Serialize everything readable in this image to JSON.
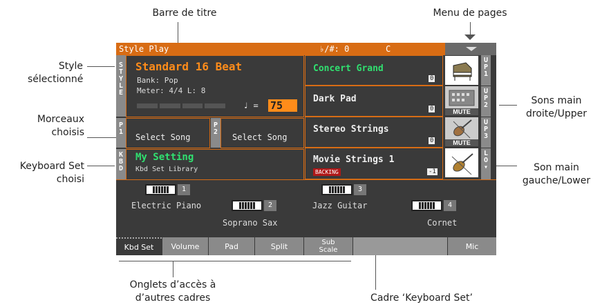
{
  "annotations": {
    "barre_titre": "Barre de titre",
    "menu_pages": "Menu de pages",
    "style_sel_1": "Style",
    "style_sel_2": "sélectionné",
    "morceaux_1": "Morceaux",
    "morceaux_2": "choisis",
    "kbdset_1": "Keyboard Set",
    "kbdset_2": "choisi",
    "upper_1": "Sons main",
    "upper_2": "droite/Upper",
    "lower_1": "Son main",
    "lower_2": "gauche/Lower",
    "onglets_1": "Onglets d’accès à",
    "onglets_2": "d’autres cadres",
    "cadre": "Cadre ‘Keyboard Set’"
  },
  "title_bar": {
    "mode": "Style Play",
    "key_label": "♭/#: 0",
    "chord": "C"
  },
  "side_tabs": {
    "style": "STYLE",
    "p1": "P1",
    "p2": "P2",
    "kbd": "KBD",
    "up1": "UP1",
    "up2": "UP2",
    "up3": "UP3",
    "lo": "LO"
  },
  "style": {
    "name": "Standard 16 Beat",
    "bank": "Bank: Pop",
    "meter": "Meter: 4/4 L:  8",
    "tempo_symbol": "♩ =",
    "tempo": "75"
  },
  "songs": {
    "p1": "Select Song",
    "p2": "Select Song"
  },
  "kbd_set": {
    "name": "My Setting",
    "library": "Kbd Set Library"
  },
  "sounds": [
    {
      "name": "Concert Grand",
      "octave": "0",
      "badge": ""
    },
    {
      "name": "Dark Pad",
      "octave": "0",
      "badge": "MUTE"
    },
    {
      "name": "Stereo Strings",
      "octave": "0",
      "badge": "MUTE"
    },
    {
      "name": "Movie Strings 1",
      "octave": "-1",
      "badge": "BACKING"
    }
  ],
  "pads": [
    {
      "name": "Electric Piano",
      "num": "1"
    },
    {
      "name": "Soprano Sax",
      "num": "2"
    },
    {
      "name": "Jazz Guitar",
      "num": "3"
    },
    {
      "name": "Cornet",
      "num": "4"
    }
  ],
  "tabs": [
    "Kbd Set",
    "Volume",
    "Pad",
    "Split",
    "Sub Scale",
    "",
    "Mic"
  ],
  "colors": {
    "accent": "#d86c14",
    "selected_text": "#30e070",
    "panel": "#3a3a3a"
  }
}
